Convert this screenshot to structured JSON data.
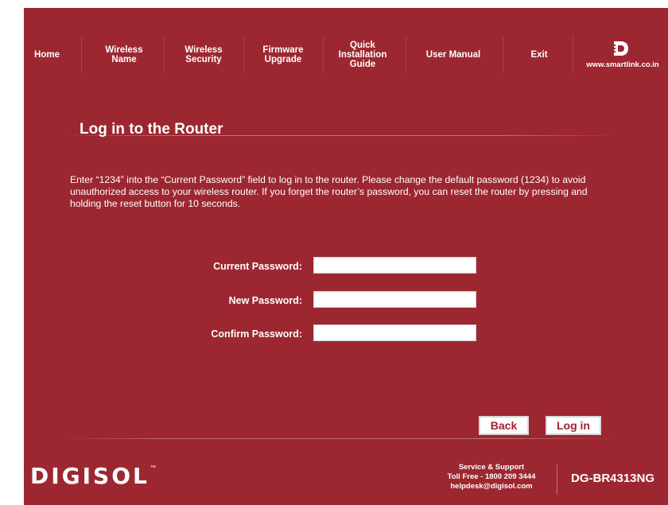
{
  "nav": {
    "items": [
      {
        "label": "Home"
      },
      {
        "label": "Wireless\nName"
      },
      {
        "label": "Wireless\nSecurity"
      },
      {
        "label": "Firmware\nUpgrade"
      },
      {
        "label": "Quick\nInstallation\nGuide"
      },
      {
        "label": "User Manual"
      },
      {
        "label": "Exit"
      }
    ],
    "brand_url": "www.smartlink.co.in",
    "brand_icon": "digisol-mark-icon"
  },
  "page": {
    "title": "Log in to the Router",
    "description": "Enter “1234” into the “Current Password” field to log in to the router. Please change the default password (1234) to avoid unauthorized access to your wireless router. If you forget the router’s password, you can reset the router by pressing and holding the reset button for 10 seconds."
  },
  "form": {
    "current_password_label": "Current Password:",
    "new_password_label": "New Password:",
    "confirm_password_label": "Confirm Password:",
    "current_password_value": "",
    "new_password_value": "",
    "confirm_password_value": ""
  },
  "buttons": {
    "back": "Back",
    "login": "Log in"
  },
  "footer": {
    "logo_text": "DIGISOL",
    "logo_tm": "™",
    "support_title": "Service & Support",
    "support_phone": "Toll Free - 1800 209 3444",
    "support_email": "helpdesk@digisol.com",
    "model": "DG-BR4313NG"
  },
  "colors": {
    "background": "#9d2730",
    "button_text": "#a2202b"
  }
}
